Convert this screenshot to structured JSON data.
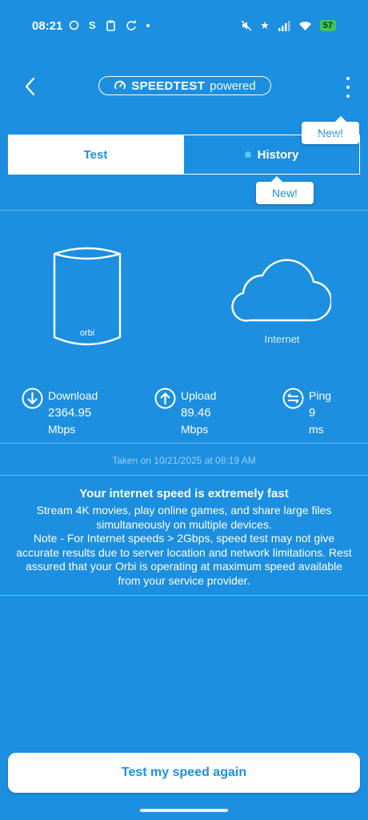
{
  "status_bar": {
    "time": "08:21",
    "battery": "57",
    "notification_s": "S"
  },
  "header": {
    "logo_brand": "SPEEDTEST",
    "logo_suffix": "powered",
    "back_icon": "chevron-left-icon",
    "menu_icon": "more-vertical-icon"
  },
  "tooltips": {
    "menu_new": "New!",
    "history_new": "New!"
  },
  "tabs": [
    {
      "label": "Test",
      "active": true
    },
    {
      "label": "History",
      "active": false
    }
  ],
  "devices": {
    "router_brand": "orbi",
    "internet_label": "Internet"
  },
  "metrics": {
    "download": {
      "label": "Download",
      "value": "2364.95",
      "unit": "Mbps",
      "icon": "arrow-down-circle-icon"
    },
    "upload": {
      "label": "Upload",
      "value": "89.46",
      "unit": "Mbps",
      "icon": "arrow-up-circle-icon"
    },
    "ping": {
      "label": "Ping",
      "value": "9",
      "unit": "ms",
      "icon": "ping-arrows-icon"
    }
  },
  "taken_on": "Taken on 10/21/2025 at 08:19 AM",
  "message": {
    "title": "Your internet speed is extremely fast",
    "body1": "Stream 4K movies, play online games, and share large files simultaneously on multiple devices.",
    "body2": "Note - For Internet speeds > 2Gbps, speed test may not give accurate results due to server location and network limitations. Rest assured that your Orbi is operating at maximum speed available from your service provider."
  },
  "action_button": "Test my speed again",
  "colors": {
    "background": "#1c8fe0",
    "accent": "#1c8fe0",
    "history_dot": "#5ac8fa"
  }
}
